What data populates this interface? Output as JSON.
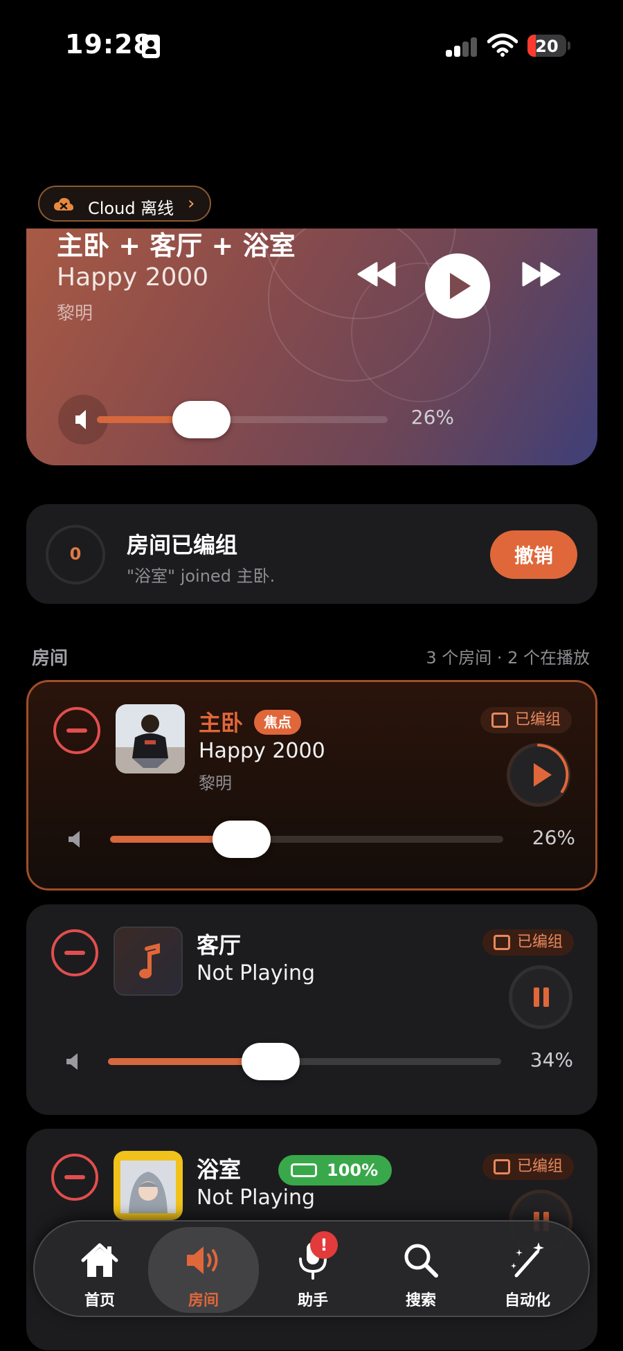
{
  "status_bar": {
    "time": "19:28",
    "battery": "20"
  },
  "cloud": {
    "label": "Cloud 离线"
  },
  "player": {
    "title": "主卧 + 客厅 + 浴室",
    "song": "Happy 2000",
    "artist": "黎明",
    "volume_percent": 26,
    "volume_label": "26%"
  },
  "group_notice": {
    "countdown": "0",
    "title": "房间已编组",
    "subtitle": "\"浴室\" joined 主卧.",
    "undo_label": "撤销"
  },
  "rooms_section": {
    "label": "房间",
    "summary": "3 个房间 · 2 个在播放"
  },
  "rooms": [
    {
      "name": "主卧",
      "focus_badge": "焦点",
      "song": "Happy 2000",
      "artist": "黎明",
      "grouped_label": "已编组",
      "state": "paused",
      "volume_percent": 26,
      "volume_label": "26%"
    },
    {
      "name": "客厅",
      "song": "Not Playing",
      "grouped_label": "已编组",
      "state": "playing",
      "volume_percent": 34,
      "volume_label": "34%"
    },
    {
      "name": "浴室",
      "battery_badge": "100%",
      "song": "Not Playing",
      "grouped_label": "已编组",
      "state": "playing"
    }
  ],
  "tabbar": {
    "tabs": [
      {
        "label": "首页",
        "icon": "home-icon"
      },
      {
        "label": "房间",
        "icon": "speaker-icon",
        "active": true
      },
      {
        "label": "助手",
        "icon": "microphone-icon",
        "badge": "!"
      },
      {
        "label": "搜索",
        "icon": "search-icon"
      },
      {
        "label": "自动化",
        "icon": "magic-wand-icon"
      }
    ]
  },
  "colors": {
    "accent": "#e0673a",
    "danger": "#e24e4e",
    "success": "#39a84a",
    "card": "#1c1c1e"
  }
}
